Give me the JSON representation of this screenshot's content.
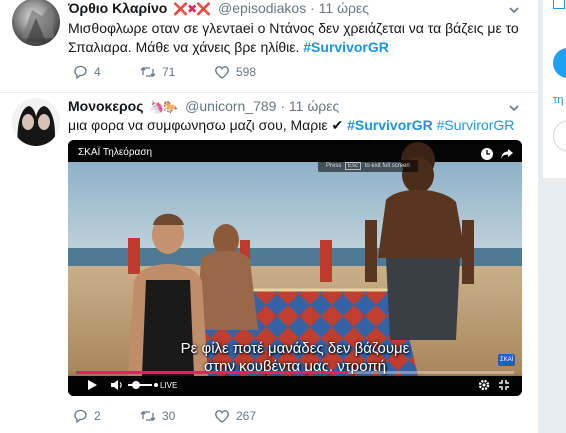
{
  "tweets": [
    {
      "name": "Όρθιο Κλαρίνο",
      "emoji": "❌✖❌",
      "handle": "@episodiakos",
      "time": "11 ώρες",
      "text_plain": "Μισθοφλωρε οταν σε γλεντaei ο Ντάνος δεν χρειάζεται να τα βάζεις με το Σπαλιαρα. Μάθε να χάνεις βρε ηλίθιε. ",
      "hashtags": [
        "#SurvivorGR"
      ],
      "replies": "4",
      "retweets": "71",
      "likes": "598"
    },
    {
      "name": "Μονοκερος",
      "emoji": "🦄🐎",
      "handle": "@unicorn_789",
      "time": "11 ώρες",
      "text_plain": "μια φορα να συμφωνησω μαζι σου, Μαριε ✔ ",
      "hashtags": [
        "#SurvivorGR",
        "#SurvirorGR"
      ],
      "video": {
        "channel_title": "ΣΚΑΪ Τηλεόραση",
        "esc_pre": "Press",
        "esc_key": "Esc",
        "esc_post": "to exit full screen",
        "subtitle_line1": "Ρε φίλε ποτέ μανάδες δεν βάζουμε",
        "subtitle_line2": "στην κουβέντα μας, ντροπή",
        "live_label": "LIVE",
        "logo": "ΣΚΑΪ",
        "progress": 0.62
      },
      "replies": "2",
      "retweets": "30",
      "likes": "267"
    }
  ],
  "side": {
    "link_text": "τη"
  },
  "colors": {
    "hashtag": "#1b95e0",
    "muted": "#657786",
    "red_x": "#e0245e"
  }
}
